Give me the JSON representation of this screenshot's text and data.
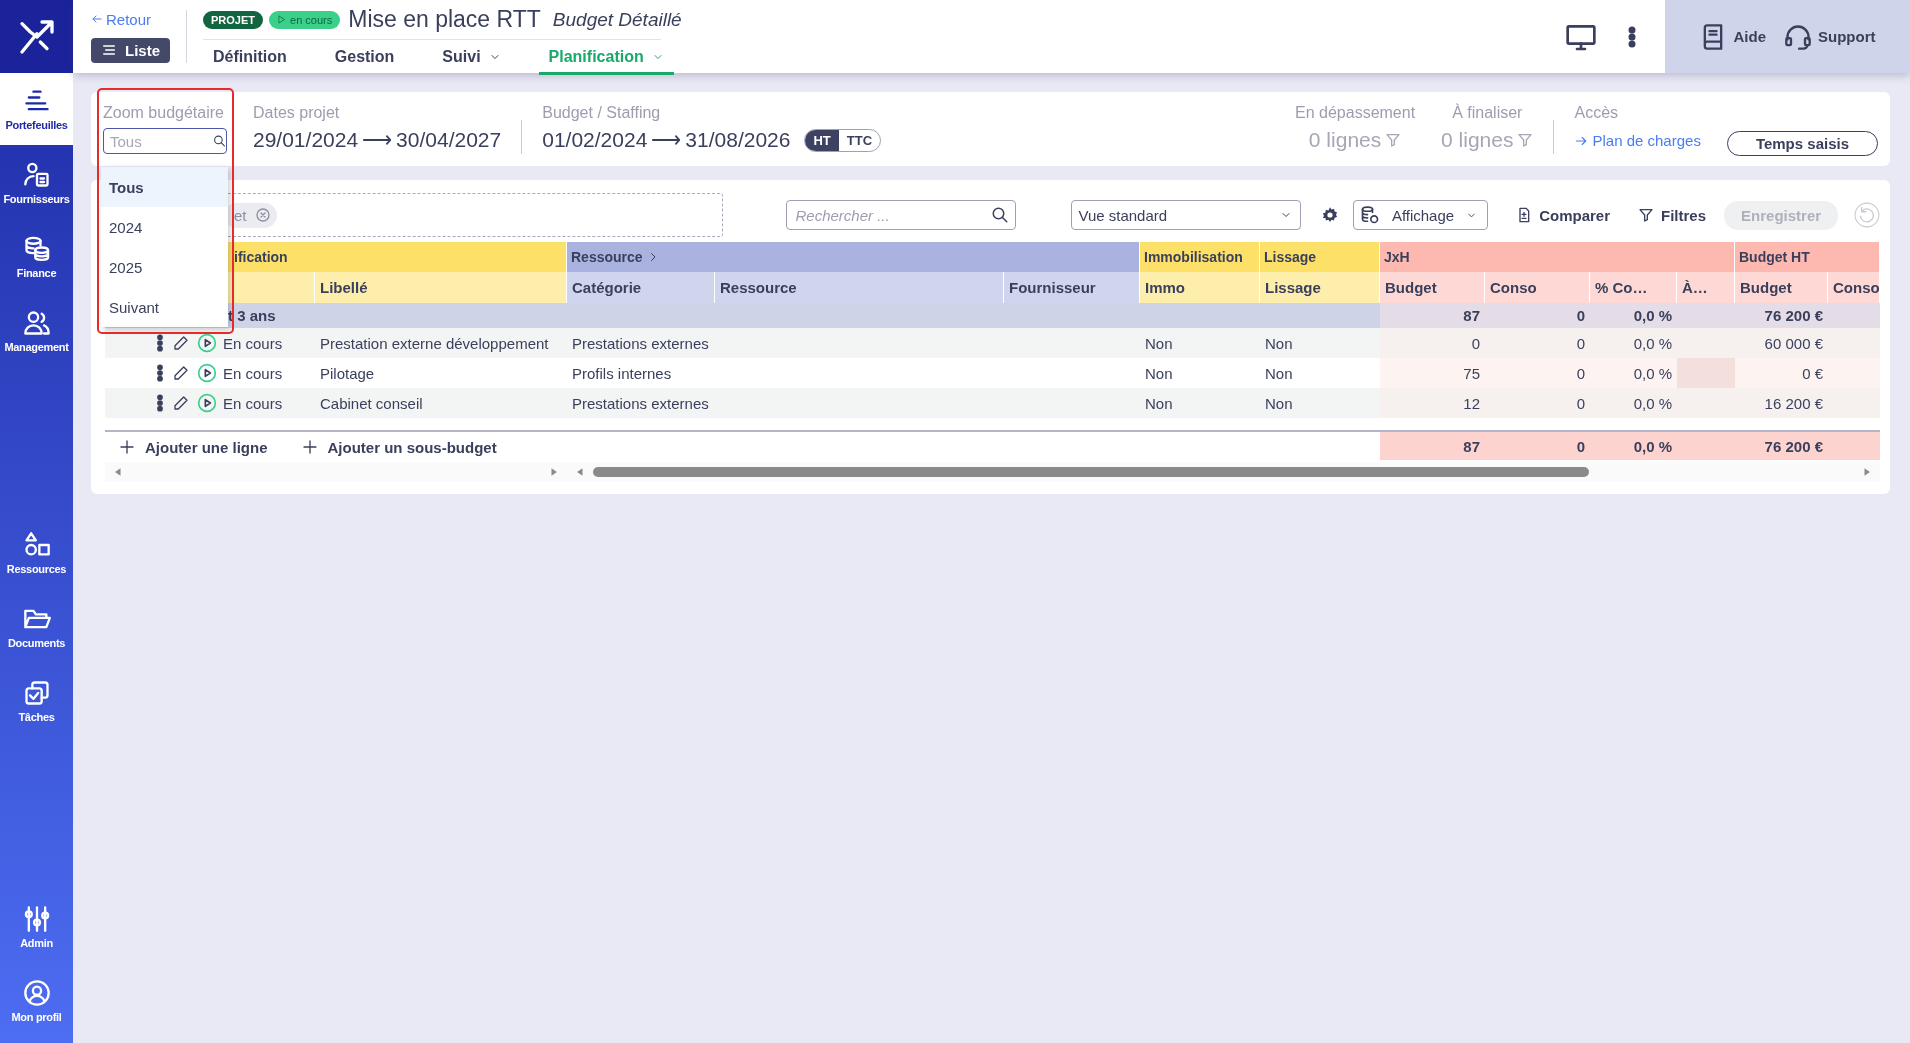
{
  "sidebar": {
    "top": [
      {
        "label": "Portefeuilles",
        "selected": true
      },
      {
        "label": "Fournisseurs",
        "selected": false
      },
      {
        "label": "Finance",
        "selected": false
      },
      {
        "label": "Management",
        "selected": false
      }
    ],
    "middle": [
      {
        "label": "Ressources",
        "selected": false
      },
      {
        "label": "Documents",
        "selected": false
      },
      {
        "label": "Tâches",
        "selected": false
      }
    ],
    "bottom": [
      {
        "label": "Admin",
        "selected": false
      },
      {
        "label": "Mon profil",
        "selected": false
      }
    ]
  },
  "header": {
    "back_link": "Retour",
    "list_button": "Liste",
    "badges": [
      {
        "label": "PROJET",
        "kind": "type"
      },
      {
        "label": "en cours",
        "kind": "status"
      }
    ],
    "title": "Mise en place RTT",
    "subtitle": "Budget Détaillé",
    "tabs": [
      {
        "label": "Définition",
        "selected": false,
        "has_menu": false
      },
      {
        "label": "Gestion",
        "selected": false,
        "has_menu": false
      },
      {
        "label": "Suivi",
        "selected": false,
        "has_menu": true
      },
      {
        "label": "Planification",
        "selected": true,
        "has_menu": true
      }
    ],
    "help": "Aide",
    "support": "Support"
  },
  "filters": {
    "zoom": {
      "label": "Zoom budgétaire",
      "placeholder": "Tous",
      "options": [
        {
          "label": "Tous",
          "selected": true
        },
        {
          "label": "2024",
          "selected": false
        },
        {
          "label": "2025",
          "selected": false
        },
        {
          "label": "Suivant",
          "selected": false
        }
      ]
    },
    "project_dates": {
      "label": "Dates projet",
      "start": "29/01/2024",
      "arrow": "⟶",
      "end": "30/04/2027"
    },
    "budget_staffing": {
      "label": "Budget / Staffing",
      "start": "01/02/2024",
      "arrow": "⟶",
      "end": "31/08/2026",
      "toggle": [
        {
          "label": "HT",
          "selected": true
        },
        {
          "label": "TTC",
          "selected": false
        }
      ]
    },
    "counters": [
      {
        "label": "En dépassement",
        "value": "0 lignes"
      },
      {
        "label": "À finaliser",
        "value": "0 lignes"
      }
    ],
    "access": {
      "label": "Accès",
      "link": "Plan de charges"
    },
    "time_button": "Temps saisis"
  },
  "toolbar": {
    "chip": "et",
    "search_placeholder": "Rechercher ...",
    "view": "Vue standard",
    "display": "Affichage",
    "compare": "Comparer",
    "filters": "Filtres",
    "save": {
      "label": "Enregistrer",
      "disabled": true
    }
  },
  "table": {
    "groups": [
      {
        "label": "ification",
        "color": "#fde068",
        "expandable": false,
        "columns": [
          {},
          {},
          {
            "label": "Libellé"
          }
        ]
      },
      {
        "label": "Ressource",
        "color": "#aab3e0",
        "expandable": true,
        "columns": [
          {
            "label": "Catégorie"
          },
          {
            "label": "Ressource"
          },
          {
            "label": "Fournisseur"
          }
        ]
      },
      {
        "label": "Immobilisation",
        "color": "#fde068",
        "expandable": false,
        "columns": [
          {
            "label": "Immo"
          }
        ]
      },
      {
        "label": "Lissage",
        "color": "#fde068",
        "expandable": false,
        "columns": [
          {
            "label": "Lissage"
          }
        ]
      },
      {
        "label": "JxH",
        "color": "#fdb8b0",
        "expandable": false,
        "columns": [
          {
            "label": "Budget"
          },
          {
            "label": "Conso"
          },
          {
            "label": "% Co…"
          },
          {
            "label": "À…"
          }
        ]
      },
      {
        "label": "Budget HT",
        "color": "#fdb8b0",
        "expandable": false,
        "columns": [
          {
            "label": "Budget"
          },
          {
            "label": "Conso"
          }
        ]
      }
    ],
    "section": {
      "label": "t 3 ans",
      "jxh_budget": "87",
      "jxh_conso": "0",
      "jxh_pct": "0,0 %",
      "ht_budget": "76 200 €"
    },
    "rows": [
      {
        "status": "En cours",
        "label": "Prestation externe développement",
        "category": "Prestations externes",
        "immo": "Non",
        "lissage": "Non",
        "jxh_budget": "0",
        "jxh_conso": "0",
        "jxh_pct": "0,0 %",
        "ht_budget": "60 000 €"
      },
      {
        "status": "En cours",
        "label": "Pilotage",
        "category": "Profils internes",
        "immo": "Non",
        "lissage": "Non",
        "jxh_budget": "75",
        "jxh_conso": "0",
        "jxh_pct": "0,0 %",
        "ht_budget": "0 €"
      },
      {
        "status": "En cours",
        "label": "Cabinet conseil",
        "category": "Prestations externes",
        "immo": "Non",
        "lissage": "Non",
        "jxh_budget": "12",
        "jxh_conso": "0",
        "jxh_pct": "0,0 %",
        "ht_budget": "16 200 €"
      }
    ],
    "add_line": "Ajouter une ligne",
    "add_sub_budget": "Ajouter un sous-budget",
    "totals": {
      "jxh_budget": "87",
      "jxh_conso": "0",
      "jxh_pct": "0,0 %",
      "ht_budget": "76 200 €"
    }
  }
}
